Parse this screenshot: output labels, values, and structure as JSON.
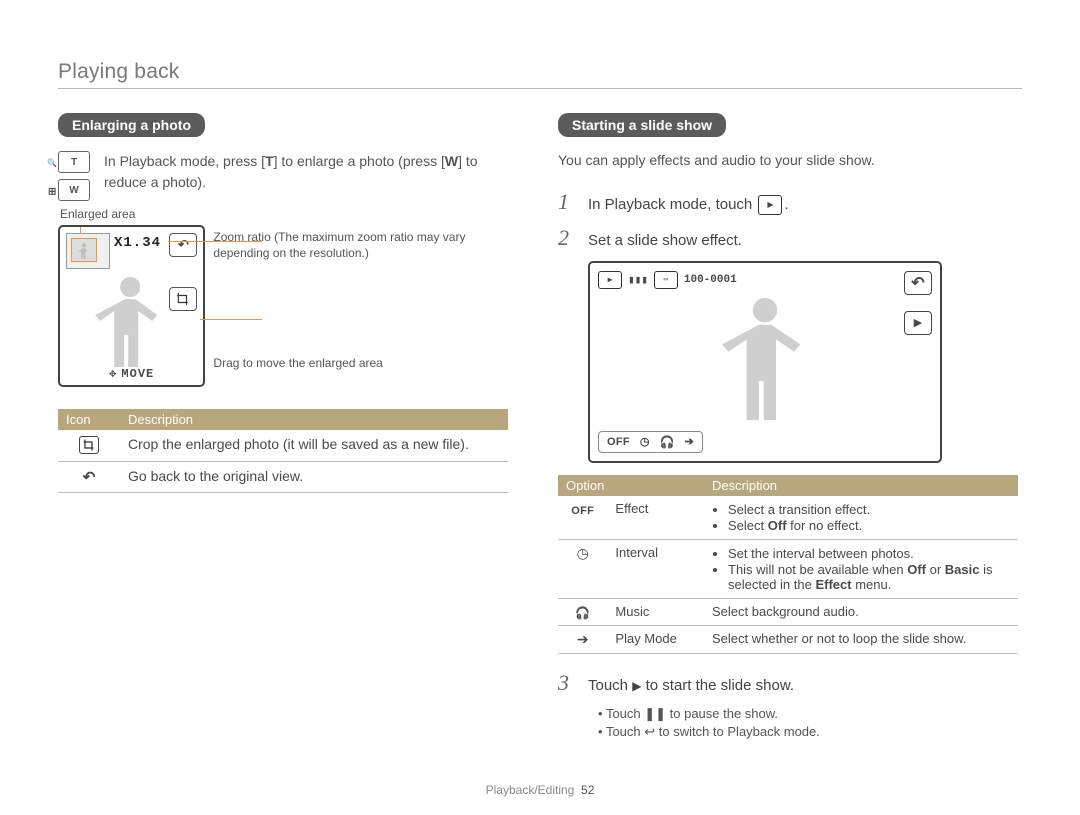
{
  "page": {
    "title": "Playing back",
    "footer_section": "Playback/Editing",
    "footer_page": "52"
  },
  "left": {
    "pill": "Enlarging a photo",
    "intro_a": "In Playback mode, press [",
    "intro_key_t": "T",
    "intro_b": "] to enlarge a photo (press [",
    "intro_key_w": "W",
    "intro_c": "] to reduce a photo).",
    "enlarged_area_label": "Enlarged area",
    "zoom_ratio_label": "Zoom ratio (The maximum zoom ratio may vary depending on the resolution.)",
    "drag_label": "Drag to move the enlarged area",
    "lcd_zoom_text": "X1.34",
    "lcd_move_text": "MOVE",
    "table_headers": {
      "icon": "Icon",
      "desc": "Description"
    },
    "rows": [
      {
        "icon": "crop",
        "desc": "Crop the enlarged photo (it will be saved as a new file)."
      },
      {
        "icon": "back",
        "desc": "Go back to the original view."
      }
    ]
  },
  "right": {
    "pill": "Starting a slide show",
    "intro": "You can apply effects and audio to your slide show.",
    "steps": {
      "s1_a": "In Playback mode, touch ",
      "s1_b": ".",
      "s2": "Set a slide show effect.",
      "s3_a": "Touch ",
      "s3_b": " to start the slide show."
    },
    "lcd_top_file": "100-0001",
    "lcd_bottom_off": "OFF",
    "opt_headers": {
      "opt": "Option",
      "desc": "Description"
    },
    "options": [
      {
        "icon_text": "OFF",
        "name": "Effect",
        "desc_list": [
          "Select a transition effect.",
          "Select <b>Off</b> for no effect."
        ]
      },
      {
        "icon_text": "clock",
        "name": "Interval",
        "desc_list": [
          "Set the interval between photos.",
          "This will not be available when <b>Off</b> or <b>Basic</b> is selected in the <b>Effect</b> menu."
        ]
      },
      {
        "icon_text": "headphones",
        "name": "Music",
        "desc_plain": "Select background audio."
      },
      {
        "icon_text": "arrow",
        "name": "Play Mode",
        "desc_plain": "Select whether or not to loop the slide show."
      }
    ],
    "sub": {
      "pause": "Touch ❚❚ to pause the show.",
      "back": "Touch ↩ to switch to Playback mode."
    }
  }
}
